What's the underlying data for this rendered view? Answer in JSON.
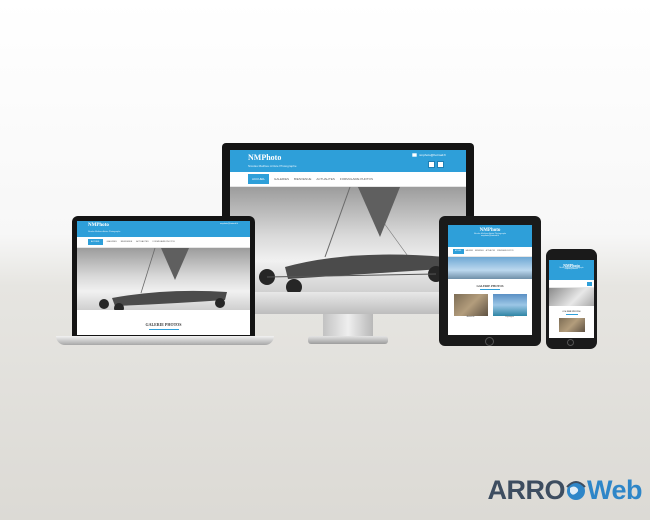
{
  "site": {
    "brand": "NMPhoto",
    "tagline": "Nicolas Mathieu Artiste Photographe",
    "email": "nmphoto@hotmail.fr",
    "nav": [
      "ACCUEIL",
      "GALERIES",
      "BIENVENUE",
      "ACTUALITES",
      "FORMULAIRE PHOTOS"
    ],
    "gallery_title": "GALERIE PHOTOS",
    "gallery_captions": [
      "Animaux",
      "Paysages"
    ]
  },
  "logo": {
    "part1": "ARRO",
    "part2": "Web"
  },
  "colors": {
    "accent": "#2e9fd9",
    "logo_dark": "#3d4d60",
    "logo_blue": "#2e86c8",
    "device_frame": "#141414"
  },
  "icons": [
    "envelope-icon",
    "facebook-icon",
    "twitter-icon",
    "globe-icon"
  ]
}
